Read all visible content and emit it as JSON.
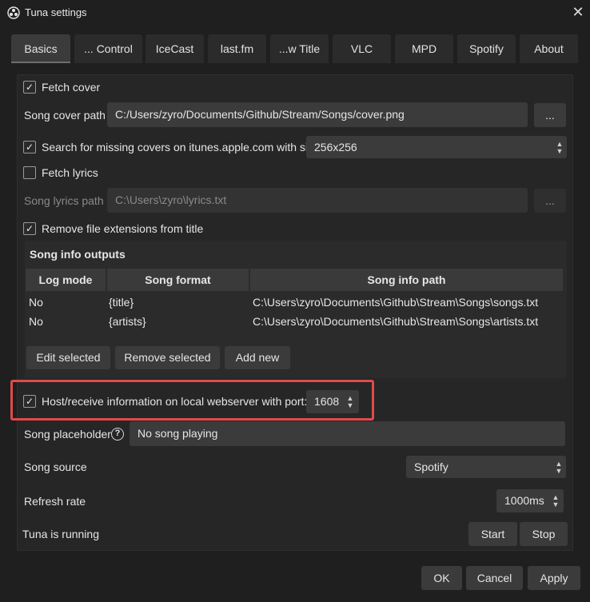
{
  "window": {
    "title": "Tuna settings"
  },
  "tabs": [
    "Basics",
    "... Control",
    "IceCast",
    "last.fm",
    "...w Title",
    "VLC",
    "MPD",
    "Spotify",
    "About"
  ],
  "basics": {
    "fetch_cover": {
      "label": "Fetch cover",
      "checked": true
    },
    "song_cover_path": {
      "label": "Song cover path",
      "value": "C:/Users/zyro/Documents/Github/Stream/Songs/cover.png",
      "browse": "..."
    },
    "search_missing": {
      "label": "Search for missing covers on itunes.apple.com with size",
      "checked": true,
      "size": "256x256"
    },
    "fetch_lyrics": {
      "label": "Fetch lyrics",
      "checked": false
    },
    "song_lyrics_path": {
      "label": "Song lyrics path",
      "value": "C:\\Users\\zyro\\lyrics.txt",
      "browse": "..."
    },
    "remove_ext": {
      "label": "Remove file extensions from title",
      "checked": true
    },
    "outputs": {
      "title": "Song info outputs",
      "columns": [
        "Log mode",
        "Song format",
        "Song info path"
      ],
      "rows": [
        [
          "No",
          "{title}",
          "C:\\Users\\zyro\\Documents\\Github\\Stream\\Songs\\songs.txt"
        ],
        [
          "No",
          "{artists}",
          "C:\\Users\\zyro\\Documents\\Github\\Stream\\Songs\\artists.txt"
        ]
      ],
      "buttons": {
        "edit": "Edit selected",
        "remove": "Remove selected",
        "add": "Add new"
      }
    },
    "webserver": {
      "label": "Host/receive information on local webserver with port:",
      "checked": true,
      "port": "1608"
    },
    "placeholder": {
      "label": "Song placeholder",
      "help": "?",
      "value": "No song playing"
    },
    "source": {
      "label": "Song source",
      "value": "Spotify"
    },
    "refresh": {
      "label": "Refresh rate",
      "value": "1000ms"
    },
    "status": {
      "label": "Tuna is running",
      "start": "Start",
      "stop": "Stop"
    }
  },
  "footer": {
    "ok": "OK",
    "cancel": "Cancel",
    "apply": "Apply"
  },
  "colors": {
    "highlight": "#e04a4a",
    "background": "#1f1f1f"
  },
  "icons": {
    "app": "obs-logo-icon",
    "close": "close-icon"
  }
}
